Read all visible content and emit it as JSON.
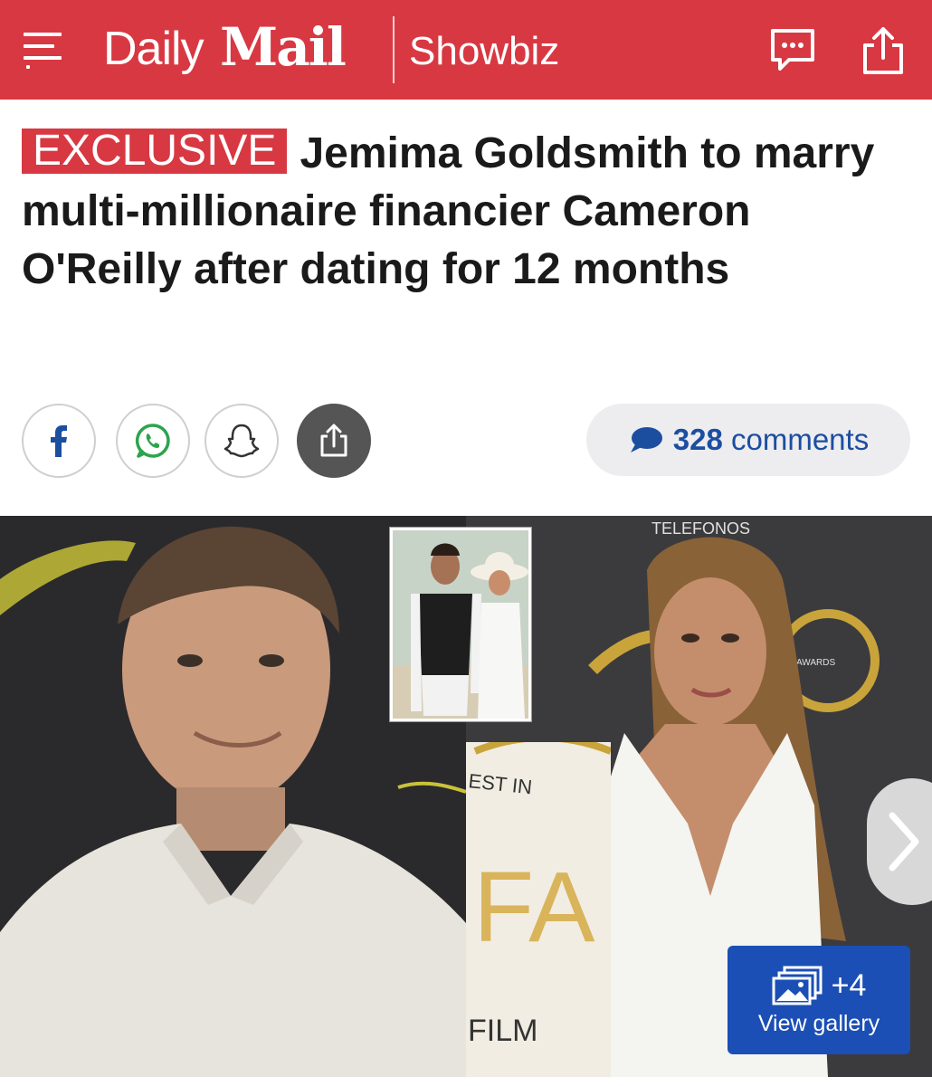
{
  "header": {
    "brand_daily": "Daily",
    "brand_mail": "Mail",
    "section": "Showbiz",
    "icons": [
      "menu-icon",
      "chat-bubble-icon",
      "share-icon"
    ],
    "color": "#d83842"
  },
  "article": {
    "tag": "EXCLUSIVE",
    "headline": "Jemima Goldsmith to marry multi-millionaire financier Cameron O'Reilly after dating for 12 months"
  },
  "share": {
    "buttons": [
      "facebook-icon",
      "whatsapp-icon",
      "snapchat-icon",
      "share-icon"
    ],
    "comments_count": "328",
    "comments_label": "comments"
  },
  "media": {
    "gallery_count": "+4",
    "gallery_label": "View gallery",
    "backdrop_text": [
      "TELEFONOS",
      "AWARDS",
      "EST IN",
      "FA",
      "FILM"
    ]
  }
}
